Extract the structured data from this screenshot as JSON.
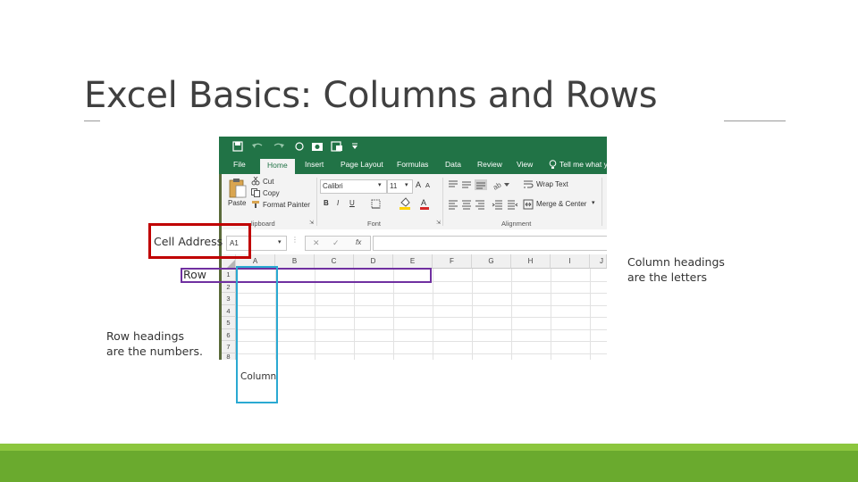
{
  "slide": {
    "title": "Excel Basics:  Columns and Rows"
  },
  "excel": {
    "ribbon_tabs": [
      "File",
      "Home",
      "Insert",
      "Page Layout",
      "Formulas",
      "Data",
      "Review",
      "View"
    ],
    "tell_me": "Tell me what y",
    "clipboard": {
      "paste": "Paste",
      "cut": "Cut",
      "copy": "Copy",
      "format_painter": "Format Painter",
      "label": "lipboard"
    },
    "font": {
      "name": "Calibri",
      "size": "11",
      "bold": "B",
      "italic": "I",
      "underline": "U",
      "label": "Font"
    },
    "alignment": {
      "wrap_text": "Wrap Text",
      "merge_center": "Merge & Center",
      "label": "Alignment"
    },
    "formula_bar": {
      "name_box": "A1",
      "fx": "fx"
    },
    "columns": [
      "A",
      "B",
      "C",
      "D",
      "E",
      "F",
      "G",
      "H",
      "I",
      "J"
    ],
    "rows": [
      "1",
      "2",
      "3",
      "4",
      "5",
      "6",
      "7",
      "8"
    ]
  },
  "annotations": {
    "cell_address": "Cell Address",
    "row": "Row",
    "row_headings_line1": "Row headings",
    "row_headings_line2": "are the numbers.",
    "column": "Column",
    "column_headings_line1": "Column headings",
    "column_headings_line2": "are the letters",
    "colors": {
      "cell_address_box": "#c00000",
      "row_box": "#7030a0",
      "column_box": "#2aa9d2",
      "excel_green": "#217346",
      "band_light": "#8cc63e",
      "band": "#6aaa2e"
    }
  }
}
